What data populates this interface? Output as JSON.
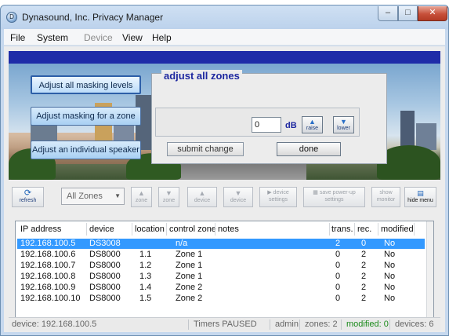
{
  "window": {
    "title": "Dynasound, Inc. Privacy Manager",
    "icon_letter": "D"
  },
  "menu": {
    "file": "File",
    "system": "System",
    "device": "Device",
    "view": "View",
    "help": "Help"
  },
  "side_buttons": {
    "adjust_all": "Adjust all masking levels",
    "adjust_zone": "Adjust masking for a zone",
    "adjust_speaker": "Adjust an individual speaker"
  },
  "zones_panel": {
    "title": "adjust all zones",
    "db_value": "0",
    "db_unit": "dB",
    "raise": "raise",
    "lower": "lower",
    "submit": "submit change",
    "done": "done"
  },
  "toolbar": {
    "refresh": "refresh",
    "zone_filter": "All Zones",
    "zone_up": "zone",
    "zone_down": "zone",
    "device_up": "device",
    "device_down": "device",
    "device_settings": "device settings",
    "save_powerup": "save power-up settings",
    "show_monitor": "show monitor",
    "hide_menu": "hide menu"
  },
  "table": {
    "columns": [
      "IP address",
      "device",
      "location",
      "control zone",
      "notes",
      "trans.",
      "rec.",
      "modified"
    ],
    "rows": [
      [
        "192.168.100.5",
        "DS3008",
        "",
        "n/a",
        "",
        "2",
        "0",
        "No"
      ],
      [
        "192.168.100.6",
        "DS8000",
        "1.1",
        "Zone 1",
        "",
        "0",
        "2",
        "No"
      ],
      [
        "192.168.100.7",
        "DS8000",
        "1.2",
        "Zone 1",
        "",
        "0",
        "2",
        "No"
      ],
      [
        "192.168.100.8",
        "DS8000",
        "1.3",
        "Zone 1",
        "",
        "0",
        "2",
        "No"
      ],
      [
        "192.168.100.9",
        "DS8000",
        "1.4",
        "Zone 2",
        "",
        "0",
        "2",
        "No"
      ],
      [
        "192.168.100.10",
        "DS8000",
        "1.5",
        "Zone 2",
        "",
        "0",
        "2",
        "No"
      ]
    ],
    "selected_row": 0
  },
  "statusbar": {
    "device": "device: 192.168.100.5",
    "timers": "Timers PAUSED",
    "user": "admin",
    "zones": "zones: 2",
    "modified": "modified: 0",
    "devices": "devices: 6"
  },
  "colors": {
    "accent_blue": "#1f2ca8",
    "selection": "#3399ff",
    "status_green": "#1a8a1a"
  }
}
